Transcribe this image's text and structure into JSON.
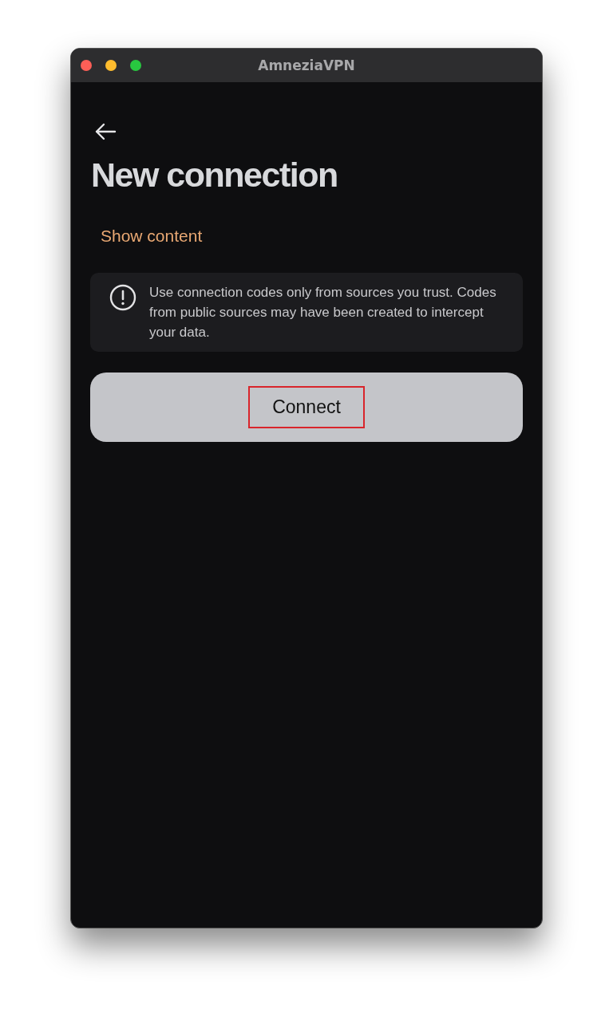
{
  "window": {
    "title": "AmneziaVPN"
  },
  "page": {
    "title": "New connection",
    "show_content_link": "Show content",
    "notice": {
      "text": "Use connection codes only from sources you trust. Codes from public sources may have been created to intercept your data."
    },
    "connect_button": {
      "label": "Connect",
      "highlighted": true
    }
  }
}
